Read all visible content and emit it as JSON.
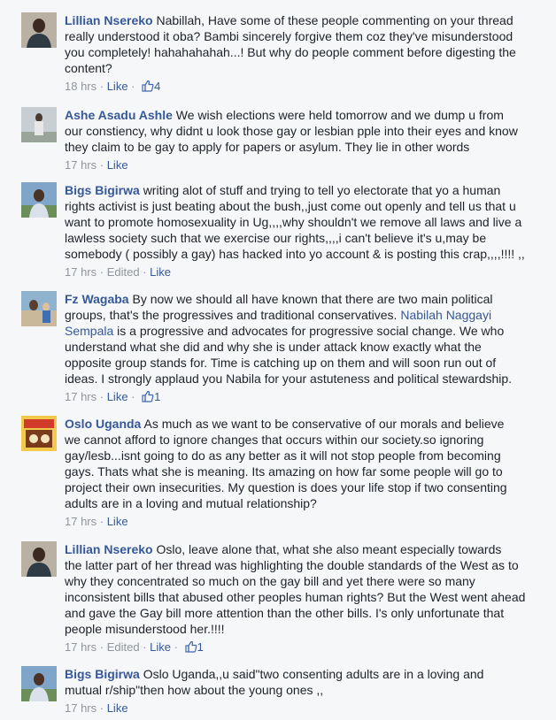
{
  "comments": [
    {
      "author": "Lillian Nsereko",
      "lines": [
        "Nabillah, Have some of these people commenting on your thread",
        "really understood it oba? Bambi sincerely forgive them coz they've misunderstood",
        "you completely! hahahahahah...! But why do people comment before digesting the",
        "content?"
      ],
      "time": "18 hrs",
      "like_label": "Like",
      "likes": "4",
      "edited": ""
    },
    {
      "author": "Ashe Asadu Ashle",
      "lines": [
        "We wish elections were held tomorrow and we dump u from",
        "our constiency, why didnt u look those gay or lesbian pple into their eyes and know",
        "they claim to be gay to apply for papers or asylum. They lie in other words"
      ],
      "time": "17 hrs",
      "like_label": "Like",
      "likes": "",
      "edited": ""
    },
    {
      "author": "Bigs Bigirwa",
      "lines": [
        "writing alot of stuff and trying to tell yo electorate that yo a human",
        "rights activist is just beating about the bush,,just come out openly and tell us that u",
        "want to promote homosexuality in Ug,,,,why shouldn't we remove all laws and live a",
        "lawless society such that we exercise our rights,,,,i can't believe it's u,may be",
        "somebody ( possibly a gay) has hacked into yo account & is posting this crap,,,,!!!! ,,"
      ],
      "time": "17 hrs",
      "like_label": "Like",
      "likes": "",
      "edited": "Edited"
    },
    {
      "author": "Fz Wagaba",
      "lines_a": [
        "By now we should all have known that there are two main political",
        "groups, that's the progressives and traditional conservatives."
      ],
      "mention_part1": "Nabilah Naggayi",
      "mention_part2": "Sempala",
      "after_mention": " is a progressive and advocates for progressive social change. We who",
      "lines_b": [
        "understand what she did and why she is under attack know exactly what the",
        "opposite group stands for. Time is catching up on them and will soon run out of",
        "ideas. I strongly applaud you Nabila for your astuteness and political stewardship."
      ],
      "time": "17 hrs",
      "like_label": "Like",
      "likes": "1",
      "edited": ""
    },
    {
      "author": "Oslo Uganda",
      "lines": [
        "As much as we want to be conservative of our morals and believe",
        "we cannot afford to ignore changes that occurs within our society.so ignoring",
        "gay/lesb...isnt going to do as any better as it will not stop people from becoming",
        "gays. Thats what she is meaning. Its amazing on how far some people will go to",
        "project their own insecurities. My question is does your life stop if two consenting",
        "adults are in a loving and mutual relationship?"
      ],
      "time": "17 hrs",
      "like_label": "Like",
      "likes": "",
      "edited": ""
    },
    {
      "author": "Lillian Nsereko",
      "lines": [
        "Oslo, leave alone that, what she also meant especially towards",
        "the latter part of her thread was highlighting the double standards of the West as to",
        "why they concentrated so much on the gay bill and yet there were so many",
        "inconsistent bills that abused other peoples human rights? But the West went ahead",
        "and gave the Gay bill more attention than the other bills. I's only unfortunate that",
        "people misunderstood her.!!!!"
      ],
      "time": "17 hrs",
      "like_label": "Like",
      "likes": "1",
      "edited": "Edited"
    },
    {
      "author": "Bigs Bigirwa",
      "lines": [
        "Oslo Uganda,,u said\"two consenting adults are in a loving and",
        "mutual r/ship\"then how about the young ones ,,"
      ],
      "time": "17 hrs",
      "like_label": "Like",
      "likes": "",
      "edited": ""
    }
  ],
  "separator": " · "
}
